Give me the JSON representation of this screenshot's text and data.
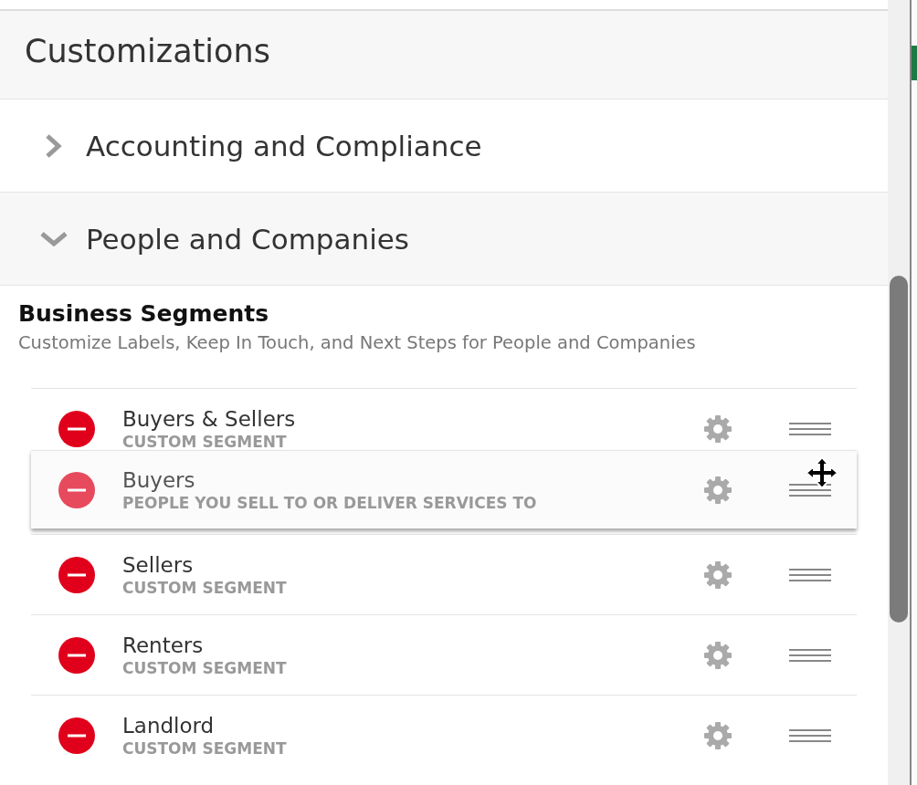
{
  "header": {
    "title": "Customizations"
  },
  "sections": [
    {
      "title": "Accounting and Compliance",
      "expanded": false
    },
    {
      "title": "People and Companies",
      "expanded": true
    }
  ],
  "group": {
    "title": "Business Segments",
    "description": "Customize Labels, Keep In Touch, and Next Steps for People and Companies"
  },
  "segments": [
    {
      "kind": "row",
      "name": "Buyers & Sellers",
      "subtitle": "CUSTOM SEGMENT"
    },
    {
      "kind": "dragged",
      "name": "Buyers",
      "subtitle": "PEOPLE YOU SELL TO OR DELIVER SERVICES TO"
    },
    {
      "kind": "row",
      "name": "Sellers",
      "subtitle": "CUSTOM SEGMENT"
    },
    {
      "kind": "row",
      "name": "Renters",
      "subtitle": "CUSTOM SEGMENT"
    },
    {
      "kind": "row",
      "name": "Landlord",
      "subtitle": "CUSTOM SEGMENT"
    }
  ]
}
